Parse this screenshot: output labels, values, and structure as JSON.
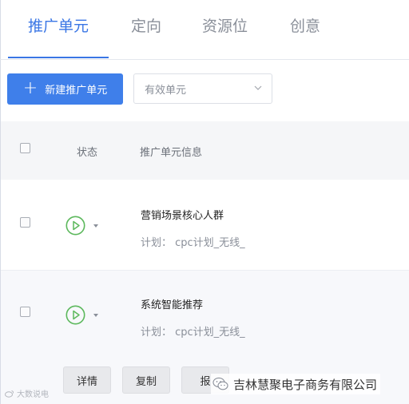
{
  "tabs": [
    {
      "label": "推广单元",
      "active": true
    },
    {
      "label": "定向",
      "active": false
    },
    {
      "label": "资源位",
      "active": false
    },
    {
      "label": "创意",
      "active": false
    }
  ],
  "toolbar": {
    "new_button_label": "新建推广单元",
    "filter_select_value": "有效单元"
  },
  "table": {
    "headers": {
      "status": "状态",
      "info": "推广单元信息"
    },
    "rows": [
      {
        "name": "营销场景核心人群",
        "plan": "计划： cpc计划_无线_",
        "status_icon": "play-circle-icon",
        "checked": false
      },
      {
        "name": "系统智能推荐",
        "plan": "计划： cpc计划_无线_",
        "status_icon": "play-circle-icon",
        "checked": false
      }
    ]
  },
  "row_actions": [
    {
      "label": "详情"
    },
    {
      "label": "复制"
    },
    {
      "label": "报"
    }
  ],
  "watermarks": {
    "left": "大数说电",
    "right": "吉林慧聚电子商务有限公司"
  },
  "colors": {
    "accent": "#3a76e5",
    "primary_button": "#3f7fea",
    "status_green": "#5cb85c"
  }
}
